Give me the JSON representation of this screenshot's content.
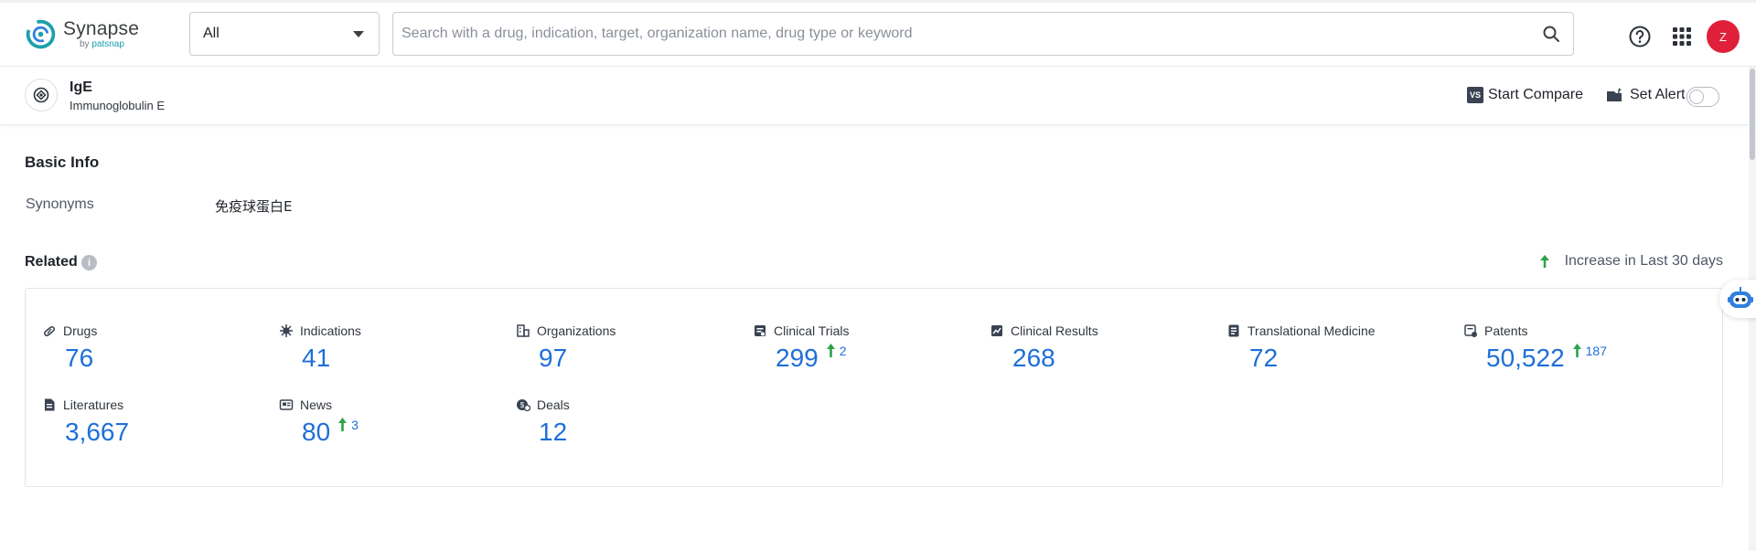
{
  "header": {
    "logo_name": "Synapse",
    "logo_by": "by",
    "logo_brand": "patsnap",
    "scope_value": "All",
    "search_placeholder": "Search with a drug, indication, target, organization name, drug type or keyword",
    "avatar_letter": "Z"
  },
  "entity": {
    "name": "IgE",
    "full_name": "Immunoglobulin E",
    "compare_badge": "VS",
    "compare_label": "Start Compare",
    "alert_label": "Set Alert",
    "alert_enabled": false
  },
  "basic_info": {
    "title": "Basic Info",
    "synonyms_label": "Synonyms",
    "synonyms_value": "免疫球蛋白E"
  },
  "related": {
    "title": "Related",
    "info_glyph": "i",
    "increase_note": "Increase in Last 30 days",
    "items": [
      {
        "label": "Drugs",
        "value": "76",
        "increase": "",
        "icon": "pill-icon"
      },
      {
        "label": "Indications",
        "value": "41",
        "increase": "",
        "icon": "virus-icon"
      },
      {
        "label": "Organizations",
        "value": "97",
        "increase": "",
        "icon": "building-icon"
      },
      {
        "label": "Clinical Trials",
        "value": "299",
        "increase": "2",
        "icon": "clipboard-icon"
      },
      {
        "label": "Clinical Results",
        "value": "268",
        "increase": "",
        "icon": "results-chart-icon"
      },
      {
        "label": "Translational Medicine",
        "value": "72",
        "increase": "",
        "icon": "document-icon"
      },
      {
        "label": "Patents",
        "value": "50,522",
        "increase": "187",
        "icon": "patent-icon"
      },
      {
        "label": "Literatures",
        "value": "3,667",
        "increase": "",
        "icon": "file-text-icon"
      },
      {
        "label": "News",
        "value": "80",
        "increase": "3",
        "icon": "newspaper-icon"
      },
      {
        "label": "Deals",
        "value": "12",
        "increase": "",
        "icon": "deal-icon"
      }
    ]
  },
  "colors": {
    "accent_blue": "#1e6fd9",
    "increase_green": "#2ba34a",
    "avatar_red": "#e0203a"
  }
}
